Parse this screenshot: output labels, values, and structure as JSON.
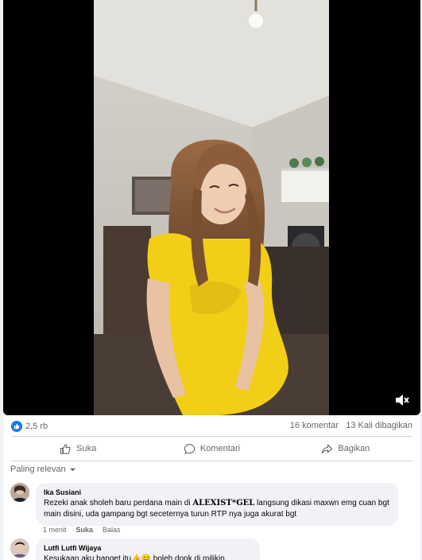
{
  "post": {
    "reactions_count": "2,5 rb",
    "comments_count": "16 komentar",
    "shares_count": "13 Kali dibagikan"
  },
  "actions": {
    "like_label": "Suka",
    "comment_label": "Komentari",
    "share_label": "Bagikan"
  },
  "sort_label": "Paling relevan",
  "comments": [
    {
      "name": "Ika Susiani",
      "text_before": "Rezeki anak sholeh baru perdana main di ",
      "text_bold": "ALEXIST*GEL",
      "text_after": " langsung dikasi maxwn emg cuan bgt main disini, uda gampang bgt seceternya turun RTP nya juga akurat bgt",
      "time": "1 menit",
      "like_label": "Suka",
      "reply_label": "Balas"
    },
    {
      "name": "Lutfi Lutfi Wijaya",
      "text": "Kesukaan aku banget itu👍😊 boleh donk di milikin"
    }
  ],
  "colors": {
    "brand_blue": "#1877f2",
    "secondary_text": "#65676b",
    "bubble_bg": "#f0f2f5"
  },
  "icons": [
    "like-icon",
    "comment-icon",
    "share-icon",
    "mute-icon",
    "chevron-down-icon"
  ]
}
